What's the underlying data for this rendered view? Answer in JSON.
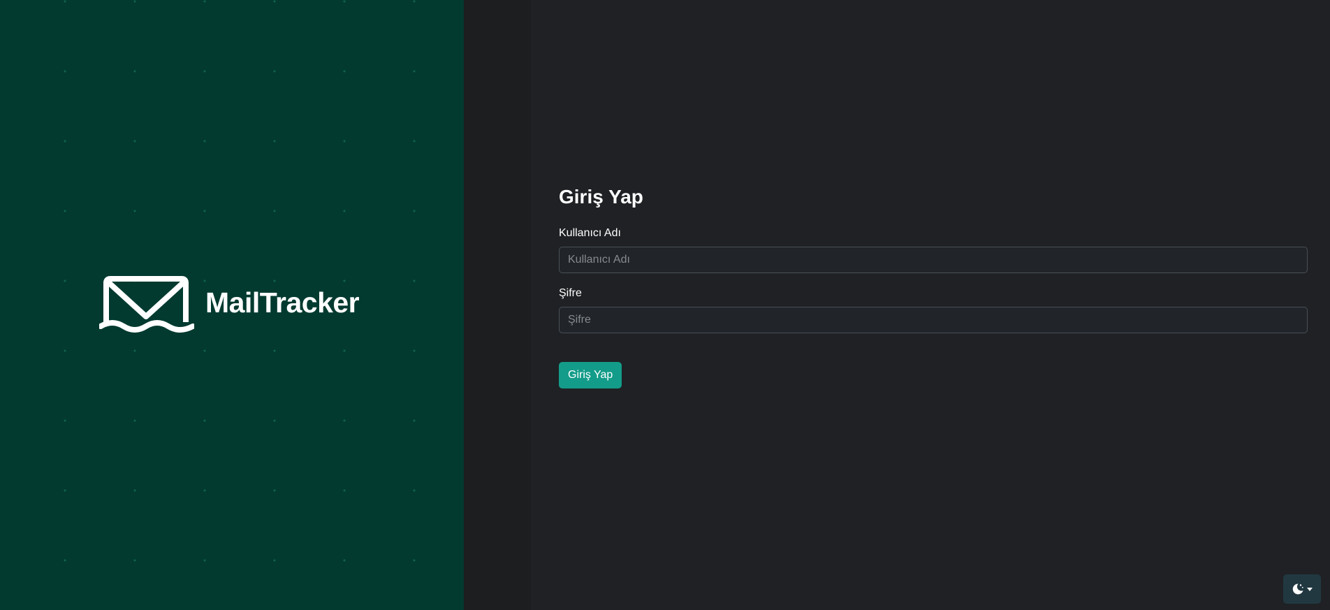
{
  "brand": {
    "name": "MailTracker",
    "logo_icon": "envelope-wave-icon"
  },
  "login": {
    "title": "Giriş Yap",
    "username": {
      "label": "Kullanıcı Adı",
      "placeholder": "Kullanıcı Adı",
      "value": ""
    },
    "password": {
      "label": "Şifre",
      "placeholder": "Şifre",
      "value": ""
    },
    "submit_label": "Giriş Yap"
  },
  "theme_toggle": {
    "icon": "moon-stars-icon",
    "dropdown_icon": "caret-down-icon"
  },
  "colors": {
    "brand_panel": "#023a30",
    "accent": "#139c89",
    "background": "#1f2124"
  }
}
